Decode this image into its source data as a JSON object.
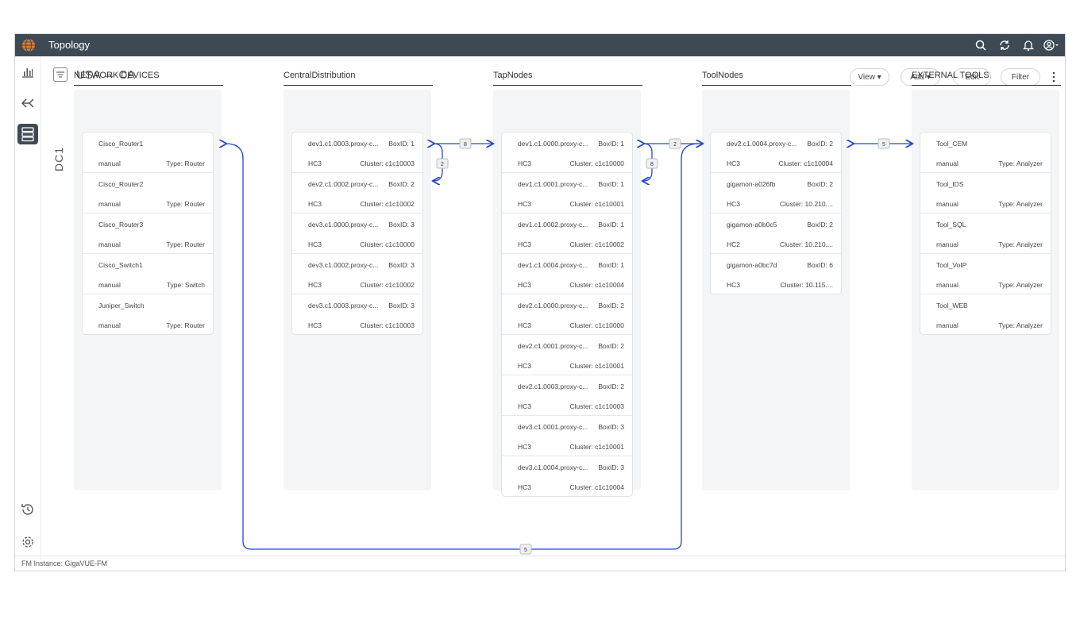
{
  "app": {
    "title": "Topology"
  },
  "breadcrumb": {
    "text": "USA → CA"
  },
  "toolbar": {
    "view": "View ▾",
    "add": "Add ▾",
    "edit": "Edit",
    "filter": "Filter"
  },
  "dc_label": "DC1",
  "footer": {
    "text": "FM Instance: GigaVUE-FM"
  },
  "columns": [
    {
      "title": "NETWORK DEVICES",
      "nodes": [
        {
          "name": "Cisco_Router1",
          "a": "",
          "b": "manual",
          "c": "Type: Router"
        },
        {
          "name": "Cisco_Router2",
          "a": "",
          "b": "manual",
          "c": "Type: Router"
        },
        {
          "name": "Cisco_Router3",
          "a": "",
          "b": "manual",
          "c": "Type: Router"
        },
        {
          "name": "Cisco_Switch1",
          "a": "",
          "b": "manual",
          "c": "Type: Switch"
        },
        {
          "name": "Juniper_Switch",
          "a": "",
          "b": "manual",
          "c": "Type: Router"
        }
      ]
    },
    {
      "title": "CentralDistribution",
      "nodes": [
        {
          "name": "dev1.c1.0003.proxy-c...",
          "a": "BoxID: 1",
          "b": "HC3",
          "c": "Cluster: c1c10003"
        },
        {
          "name": "dev2.c1.0002.proxy-c...",
          "a": "BoxID: 2",
          "b": "HC3",
          "c": "Cluster: c1c10002"
        },
        {
          "name": "dev3.c1.0000.proxy-c...",
          "a": "BoxID: 3",
          "b": "HC3",
          "c": "Cluster: c1c10000"
        },
        {
          "name": "dev3.c1.0002.proxy-c...",
          "a": "BoxID: 3",
          "b": "HC3",
          "c": "Cluster: c1c10002"
        },
        {
          "name": "dev3.c1.0003.proxy-c...",
          "a": "BoxID: 3",
          "b": "HC3",
          "c": "Cluster: c1c10003"
        }
      ]
    },
    {
      "title": "TapNodes",
      "nodes": [
        {
          "name": "dev1.c1.0000.proxy-c...",
          "a": "BoxID: 1",
          "b": "HC3",
          "c": "Cluster: c1c10000"
        },
        {
          "name": "dev1.c1.0001.proxy-c...",
          "a": "BoxID: 1",
          "b": "HC3",
          "c": "Cluster: c1c10001"
        },
        {
          "name": "dev1.c1.0002.proxy-c...",
          "a": "BoxID: 1",
          "b": "HC3",
          "c": "Cluster: c1c10002"
        },
        {
          "name": "dev1.c1.0004.proxy-c...",
          "a": "BoxID: 1",
          "b": "HC3",
          "c": "Cluster: c1c10004"
        },
        {
          "name": "dev2.c1.0000.proxy-c...",
          "a": "BoxID: 2",
          "b": "HC3",
          "c": "Cluster: c1c10000"
        },
        {
          "name": "dev2.c1.0001.proxy-c...",
          "a": "BoxID: 2",
          "b": "HC3",
          "c": "Cluster: c1c10001"
        },
        {
          "name": "dev2.c1.0003.proxy-c...",
          "a": "BoxID: 2",
          "b": "HC3",
          "c": "Cluster: c1c10003"
        },
        {
          "name": "dev3.c1.0001.proxy-c...",
          "a": "BoxID: 3",
          "b": "HC3",
          "c": "Cluster: c1c10001"
        },
        {
          "name": "dev3.c1.0004.proxy-c...",
          "a": "BoxID: 3",
          "b": "HC3",
          "c": "Cluster: c1c10004"
        }
      ]
    },
    {
      "title": "ToolNodes",
      "nodes": [
        {
          "name": "dev2.c1.0004.proxy-c...",
          "a": "BoxID: 2",
          "b": "HC3",
          "c": "Cluster: c1c10004"
        },
        {
          "name": "gigamon-a026fb",
          "a": "BoxID: 2",
          "b": "HC3",
          "c": "Cluster: 10.210...."
        },
        {
          "name": "gigamon-a0b0c5",
          "a": "BoxID: 2",
          "b": "HC2",
          "c": "Cluster: 10.210...."
        },
        {
          "name": "gigamon-a0bc7d",
          "a": "BoxID: 6",
          "b": "HC3",
          "c": "Cluster: 10.115...."
        }
      ]
    },
    {
      "title": "EXTERNAL TOOLS",
      "nodes": [
        {
          "name": "Tool_CEM",
          "a": "",
          "b": "manual",
          "c": "Type: Analyzer"
        },
        {
          "name": "Tool_IDS",
          "a": "",
          "b": "manual",
          "c": "Type: Analyzer"
        },
        {
          "name": "Tool_SQL",
          "a": "",
          "b": "manual",
          "c": "Type: Analyzer"
        },
        {
          "name": "Tool_VoIP",
          "a": "",
          "b": "manual",
          "c": "Type: Analyzer"
        },
        {
          "name": "Tool_WEB",
          "a": "",
          "b": "manual",
          "c": "Type: Analyzer"
        }
      ]
    }
  ],
  "links": {
    "cd_tap": "8",
    "cd_self": "2",
    "tap_tool": "2",
    "tap_self": "8",
    "tool_ext": "5",
    "net_tool": "5"
  },
  "colors": {
    "topbar": "#3d4a53",
    "link": "#2446d6",
    "accent": "#e07a2e"
  }
}
